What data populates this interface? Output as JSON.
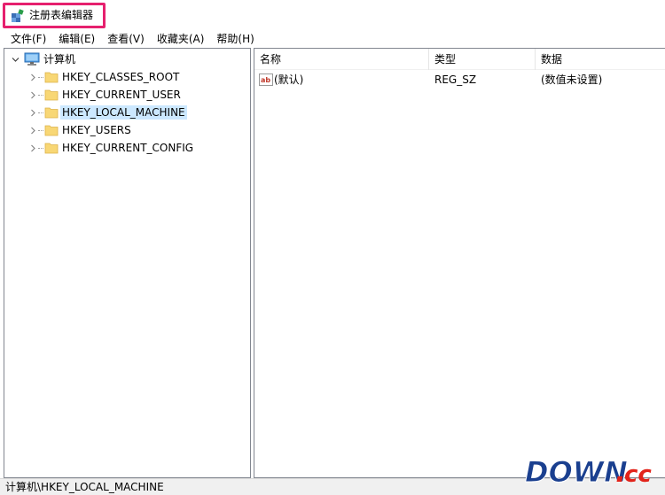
{
  "window": {
    "title": "注册表编辑器",
    "highlight_color": "#e6206e"
  },
  "menu": {
    "items": [
      {
        "label": "文件(F)"
      },
      {
        "label": "编辑(E)"
      },
      {
        "label": "查看(V)"
      },
      {
        "label": "收藏夹(A)"
      },
      {
        "label": "帮助(H)"
      }
    ]
  },
  "tree": {
    "root": {
      "label": "计算机",
      "expanded": true
    },
    "nodes": [
      {
        "label": "HKEY_CLASSES_ROOT",
        "selected": false
      },
      {
        "label": "HKEY_CURRENT_USER",
        "selected": false
      },
      {
        "label": "HKEY_LOCAL_MACHINE",
        "selected": true
      },
      {
        "label": "HKEY_USERS",
        "selected": false
      },
      {
        "label": "HKEY_CURRENT_CONFIG",
        "selected": false
      }
    ]
  },
  "list": {
    "columns": [
      "名称",
      "类型",
      "数据"
    ],
    "rows": [
      {
        "name": "(默认)",
        "type": "REG_SZ",
        "data": "(数值未设置)",
        "icon": "string-value-icon"
      }
    ]
  },
  "status": {
    "path": "计算机\\HKEY_LOCAL_MACHINE"
  },
  "watermark": {
    "text_main": "DOWN",
    "text_dot": ".",
    "text_cc": "cc",
    "accent": "#e2231a",
    "color": "#1a3f8f"
  },
  "selection_color": "#cce8ff"
}
